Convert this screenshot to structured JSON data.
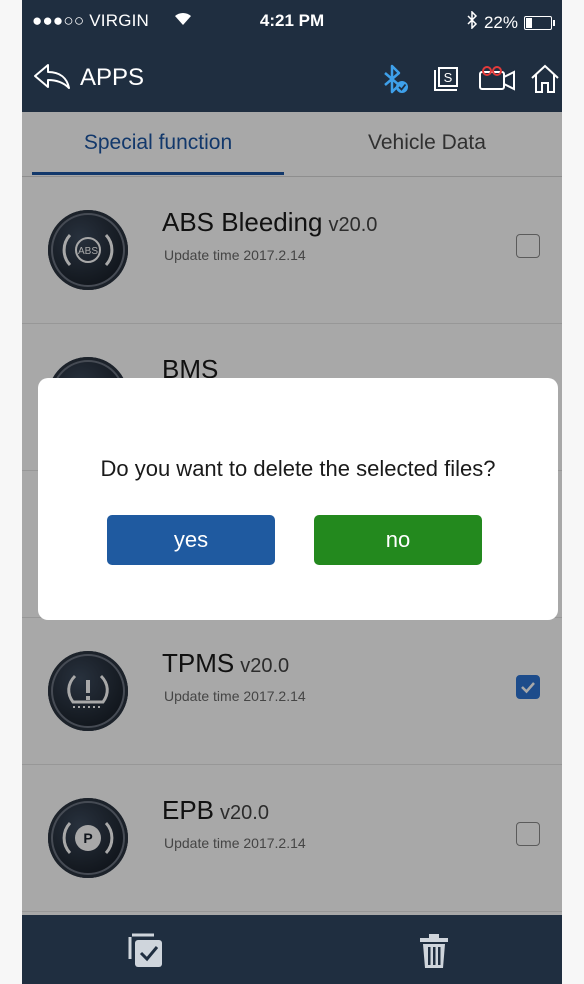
{
  "status_bar": {
    "carrier": "●●●○○ VIRGIN",
    "time": "4:21 PM",
    "battery": "22%"
  },
  "header": {
    "back_label": "APPS",
    "icons": [
      "bluetooth-icon",
      "s-box-icon",
      "camera-icon",
      "home-icon"
    ]
  },
  "tabs": [
    {
      "label": "Special function",
      "active": true
    },
    {
      "label": "Vehicle Data",
      "active": false
    }
  ],
  "list": [
    {
      "name": "ABS Bleeding",
      "version": "v20.0",
      "updated": "Update time 2017.2.14",
      "checked": false,
      "icon": "abs-icon"
    },
    {
      "name": "BMS",
      "version": "",
      "updated": "",
      "checked": false,
      "icon": "bms-icon"
    },
    {
      "name": "",
      "version": "",
      "updated": "",
      "checked": false,
      "icon": ""
    },
    {
      "name": "TPMS",
      "version": "v20.0",
      "updated": "Update time 2017.2.14",
      "checked": true,
      "icon": "tpms-icon"
    },
    {
      "name": "EPB",
      "version": "v20.0",
      "updated": "Update time 2017.2.14",
      "checked": false,
      "icon": "epb-icon"
    }
  ],
  "dialog": {
    "message": "Do you want to delete the selected files?",
    "yes_label": "yes",
    "no_label": "no"
  },
  "bottom_bar": {
    "icons": [
      "select-all-icon",
      "trash-icon"
    ]
  },
  "colors": {
    "header_bg": "#1f2e40",
    "accent": "#1c56a3",
    "yes_button": "#1f5aa0",
    "no_button": "#23891e",
    "checkbox_checked": "#2c74d4"
  }
}
